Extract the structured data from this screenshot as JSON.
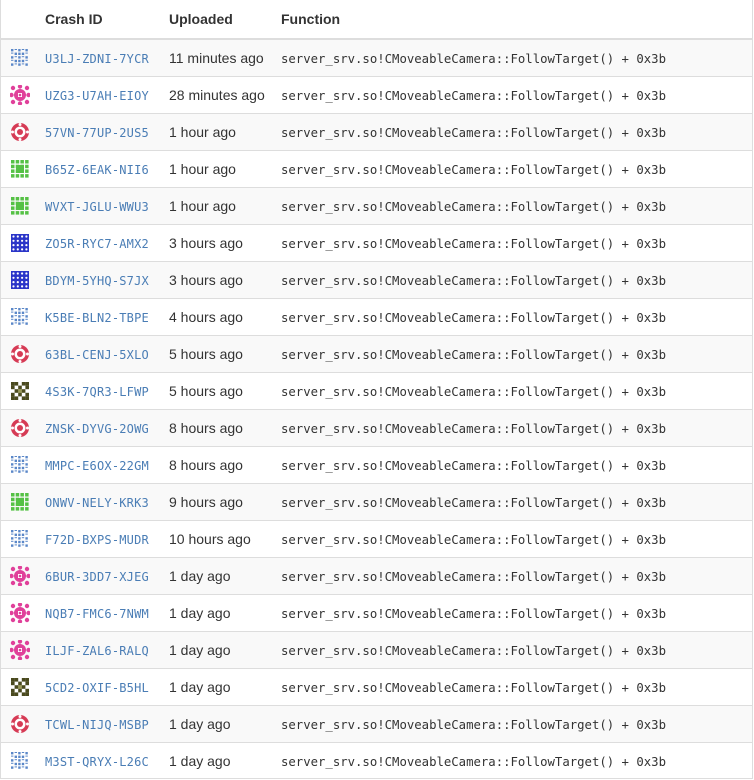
{
  "headers": {
    "crash_id": "Crash ID",
    "uploaded": "Uploaded",
    "function": "Function"
  },
  "palette": {
    "grid-blue": "#5a87c8",
    "flower-pink": "#e0409a",
    "ring-red": "#d63b55",
    "leaf-green": "#55c145",
    "dot-navy": "#2a35c8",
    "maze-olive": "#4a4a1e"
  },
  "rows": [
    {
      "icon": "grid-blue",
      "crash_id": "U3LJ-ZDNI-7YCR",
      "uploaded": "11 minutes ago",
      "function": "server_srv.so!CMoveableCamera::FollowTarget() + 0x3b"
    },
    {
      "icon": "flower-pink",
      "crash_id": "UZG3-U7AH-EIOY",
      "uploaded": "28 minutes ago",
      "function": "server_srv.so!CMoveableCamera::FollowTarget() + 0x3b"
    },
    {
      "icon": "ring-red",
      "crash_id": "57VN-77UP-2US5",
      "uploaded": "1 hour ago",
      "function": "server_srv.so!CMoveableCamera::FollowTarget() + 0x3b"
    },
    {
      "icon": "leaf-green",
      "crash_id": "B65Z-6EAK-NII6",
      "uploaded": "1 hour ago",
      "function": "server_srv.so!CMoveableCamera::FollowTarget() + 0x3b"
    },
    {
      "icon": "leaf-green",
      "crash_id": "WVXT-JGLU-WWU3",
      "uploaded": "1 hour ago",
      "function": "server_srv.so!CMoveableCamera::FollowTarget() + 0x3b"
    },
    {
      "icon": "dot-navy",
      "crash_id": "ZO5R-RYC7-AMX2",
      "uploaded": "3 hours ago",
      "function": "server_srv.so!CMoveableCamera::FollowTarget() + 0x3b"
    },
    {
      "icon": "dot-navy",
      "crash_id": "BDYM-5YHQ-S7JX",
      "uploaded": "3 hours ago",
      "function": "server_srv.so!CMoveableCamera::FollowTarget() + 0x3b"
    },
    {
      "icon": "grid-blue",
      "crash_id": "K5BE-BLN2-TBPE",
      "uploaded": "4 hours ago",
      "function": "server_srv.so!CMoveableCamera::FollowTarget() + 0x3b"
    },
    {
      "icon": "ring-red",
      "crash_id": "63BL-CENJ-5XLO",
      "uploaded": "5 hours ago",
      "function": "server_srv.so!CMoveableCamera::FollowTarget() + 0x3b"
    },
    {
      "icon": "maze-olive",
      "crash_id": "4S3K-7QR3-LFWP",
      "uploaded": "5 hours ago",
      "function": "server_srv.so!CMoveableCamera::FollowTarget() + 0x3b"
    },
    {
      "icon": "ring-red",
      "crash_id": "ZNSK-DYVG-2OWG",
      "uploaded": "8 hours ago",
      "function": "server_srv.so!CMoveableCamera::FollowTarget() + 0x3b"
    },
    {
      "icon": "grid-blue",
      "crash_id": "MMPC-E6OX-22GM",
      "uploaded": "8 hours ago",
      "function": "server_srv.so!CMoveableCamera::FollowTarget() + 0x3b"
    },
    {
      "icon": "leaf-green",
      "crash_id": "ONWV-NELY-KRK3",
      "uploaded": "9 hours ago",
      "function": "server_srv.so!CMoveableCamera::FollowTarget() + 0x3b"
    },
    {
      "icon": "grid-blue",
      "crash_id": "F72D-BXPS-MUDR",
      "uploaded": "10 hours ago",
      "function": "server_srv.so!CMoveableCamera::FollowTarget() + 0x3b"
    },
    {
      "icon": "flower-pink",
      "crash_id": "6BUR-3DD7-XJEG",
      "uploaded": "1 day ago",
      "function": "server_srv.so!CMoveableCamera::FollowTarget() + 0x3b"
    },
    {
      "icon": "flower-pink",
      "crash_id": "NQB7-FMC6-7NWM",
      "uploaded": "1 day ago",
      "function": "server_srv.so!CMoveableCamera::FollowTarget() + 0x3b"
    },
    {
      "icon": "flower-pink",
      "crash_id": "ILJF-ZAL6-RALQ",
      "uploaded": "1 day ago",
      "function": "server_srv.so!CMoveableCamera::FollowTarget() + 0x3b"
    },
    {
      "icon": "maze-olive",
      "crash_id": "5CD2-OXIF-B5HL",
      "uploaded": "1 day ago",
      "function": "server_srv.so!CMoveableCamera::FollowTarget() + 0x3b"
    },
    {
      "icon": "ring-red",
      "crash_id": "TCWL-NIJQ-MSBP",
      "uploaded": "1 day ago",
      "function": "server_srv.so!CMoveableCamera::FollowTarget() + 0x3b"
    },
    {
      "icon": "grid-blue",
      "crash_id": "M3ST-QRYX-L26C",
      "uploaded": "1 day ago",
      "function": "server_srv.so!CMoveableCamera::FollowTarget() + 0x3b"
    }
  ]
}
